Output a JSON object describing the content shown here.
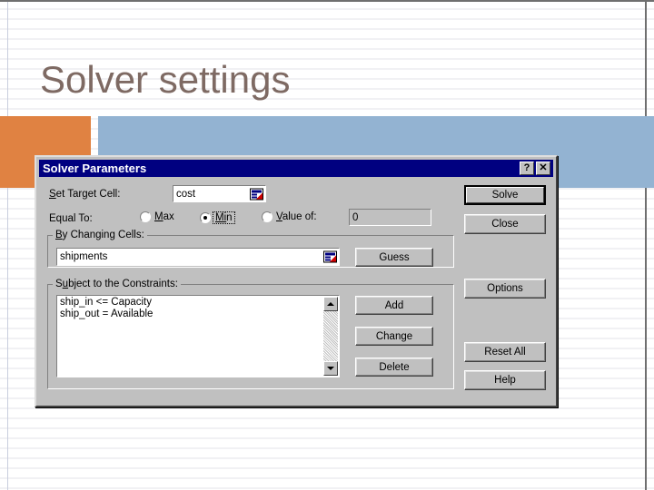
{
  "slide": {
    "title": "Solver settings",
    "title_color": "#7e6a63",
    "accent_orange": "#e08242",
    "accent_blue": "#93b3d2"
  },
  "dialog": {
    "titlebar": {
      "title": "Solver Parameters",
      "help_button": "?",
      "close_button": "✕",
      "background": "#000080"
    },
    "target": {
      "label_prefix": "S",
      "label": "Set Target Cell:",
      "value": "cost",
      "picker_icon": "range-selector-icon"
    },
    "equal_to": {
      "label": "Equal To:",
      "options": [
        {
          "label": "Max",
          "selected": false
        },
        {
          "label": "Min",
          "selected": true
        },
        {
          "label": "Value of:",
          "selected": false
        }
      ],
      "value_of": "0"
    },
    "changing_cells": {
      "group_label": "By Changing Cells:",
      "value": "shipments",
      "guess_button": "Guess",
      "picker_icon": "range-selector-icon"
    },
    "constraints": {
      "group_label": "Subject to the Constraints:",
      "items": [
        "ship_in <= Capacity",
        "ship_out = Available"
      ],
      "buttons": [
        "Add",
        "Change",
        "Delete"
      ],
      "scroll_up_icon": "triangle-up-icon",
      "scroll_down_icon": "triangle-down-icon"
    },
    "action_buttons": [
      {
        "label": "Solve",
        "default": true
      },
      {
        "label": "Close",
        "default": false
      },
      {
        "label": "Options",
        "default": false
      },
      {
        "label": "Reset All",
        "default": false
      },
      {
        "label": "Help",
        "default": false
      }
    ]
  }
}
